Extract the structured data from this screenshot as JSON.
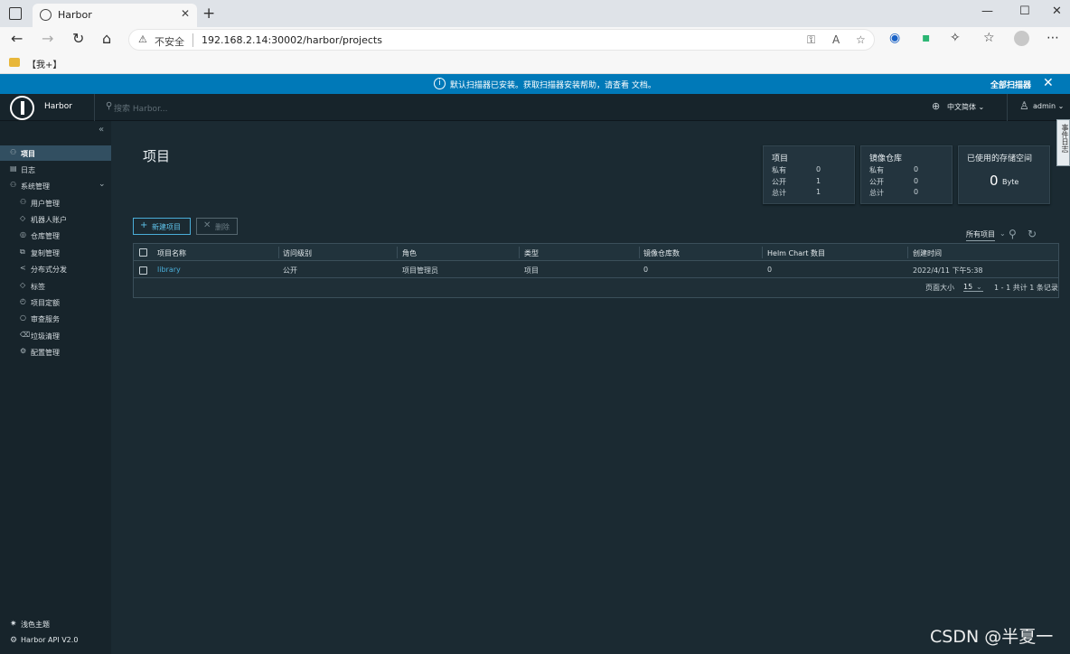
{
  "browser": {
    "tab_title": "Harbor",
    "security_label": "不安全",
    "url": "192.168.2.14:30002/harbor/projects",
    "bookmark": "【我+】"
  },
  "banner": {
    "message": "默认扫描器已安装。获取扫描器安装帮助，请查看 文档。",
    "action": "全部扫描器"
  },
  "header": {
    "brand": "Harbor",
    "search_placeholder": "搜索 Harbor...",
    "language": "中文简体",
    "user": "admin"
  },
  "sidebar": {
    "items": [
      {
        "label": "项目",
        "icon": "projects-icon",
        "active": true
      },
      {
        "label": "日志",
        "icon": "logs-icon"
      },
      {
        "label": "系统管理",
        "icon": "admin-icon"
      },
      {
        "label": "用户管理",
        "icon": "users-icon"
      },
      {
        "label": "机器人账户",
        "icon": "robot-icon"
      },
      {
        "label": "仓库管理",
        "icon": "registry-icon"
      },
      {
        "label": "复制管理",
        "icon": "replication-icon"
      },
      {
        "label": "分布式分发",
        "icon": "distribution-icon"
      },
      {
        "label": "标签",
        "icon": "tag-icon"
      },
      {
        "label": "项目定额",
        "icon": "quota-icon"
      },
      {
        "label": "审查服务",
        "icon": "scan-icon"
      },
      {
        "label": "垃圾清理",
        "icon": "trash-icon"
      },
      {
        "label": "配置管理",
        "icon": "config-icon"
      }
    ],
    "theme_toggle": "浅色主题",
    "api_link": "Harbor API V2.0"
  },
  "main": {
    "title": "项目",
    "cards": {
      "projects": {
        "title": "项目",
        "rows": [
          {
            "label": "私有",
            "value": "0"
          },
          {
            "label": "公开",
            "value": "1"
          },
          {
            "label": "总计",
            "value": "1"
          }
        ]
      },
      "repos": {
        "title": "镜像仓库",
        "rows": [
          {
            "label": "私有",
            "value": "0"
          },
          {
            "label": "公开",
            "value": "0"
          },
          {
            "label": "总计",
            "value": "0"
          }
        ]
      },
      "storage": {
        "title": "已使用的存储空间",
        "value": "0",
        "unit": "Byte"
      }
    },
    "new_button": "新建项目",
    "delete_button": "删除",
    "filter": "所有项目",
    "table": {
      "headers": [
        "项目名称",
        "访问级别",
        "角色",
        "类型",
        "镜像仓库数",
        "Helm Chart 数目",
        "创建时间"
      ],
      "rows": [
        [
          "library",
          "公开",
          "项目管理员",
          "项目",
          "0",
          "0",
          "2022/4/11 下午5:38"
        ]
      ],
      "page_size_label": "页面大小",
      "page_size": "15",
      "page_info": "1 - 1 共计 1 条记录"
    },
    "event_tab": "事件日志"
  },
  "watermark": "CSDN @半夏一"
}
